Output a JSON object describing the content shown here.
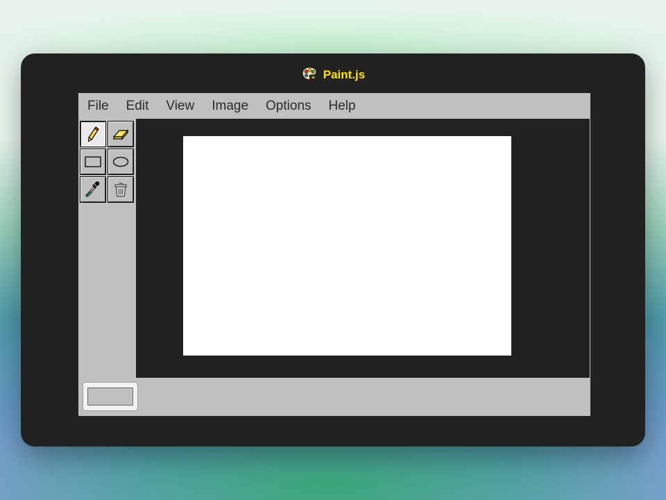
{
  "window": {
    "title": "Paint.js",
    "icon": "palette-icon",
    "title_color": "#ffe400",
    "frame_color": "#222222"
  },
  "menubar": {
    "items": [
      {
        "label": "File"
      },
      {
        "label": "Edit"
      },
      {
        "label": "View"
      },
      {
        "label": "Image"
      },
      {
        "label": "Options"
      },
      {
        "label": "Help"
      }
    ]
  },
  "toolbox": {
    "tools": [
      {
        "name": "pencil",
        "icon": "pencil-icon",
        "selected": true
      },
      {
        "name": "eraser",
        "icon": "eraser-icon",
        "selected": false
      },
      {
        "name": "rectangle",
        "icon": "rectangle-icon",
        "selected": false
      },
      {
        "name": "ellipse",
        "icon": "ellipse-icon",
        "selected": false
      },
      {
        "name": "color-picker",
        "icon": "eyedropper-icon",
        "selected": false
      },
      {
        "name": "clear",
        "icon": "trash-icon",
        "selected": false
      }
    ]
  },
  "canvas": {
    "background": "#ffffff"
  },
  "statusbar": {
    "current_color": "#c0c0c0"
  }
}
